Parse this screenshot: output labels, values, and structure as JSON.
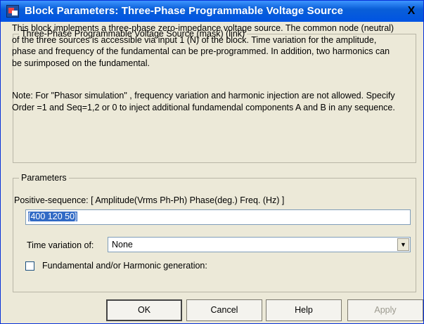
{
  "window": {
    "title": "Block Parameters: Three-Phase Programmable Voltage Source",
    "close_label": "X"
  },
  "description_group": {
    "legend": "Three-Phase Programmable Voltage Source (mask) (link)",
    "text": "This block implements a three-phase zero-impedance voltage source. The common node (neutral) of the three sources is accessible via input 1 (N) of the block. Time variation for the amplitude, phase and frequency of the fundamental can be pre-programmed. In addition, two harmonics can be surimposed on the fundamental.",
    "note": "Note: For \"Phasor simulation\" , frequency variation and harmonic injection are not allowed. Specify Order =1 and Seq=1,2 or 0 to inject additional fundamendal components A and B in any sequence."
  },
  "parameters": {
    "legend": "Parameters",
    "positive_sequence_label": "Positive-sequence: [ Amplitude(Vrms Ph-Ph) Phase(deg.) Freq. (Hz) ]",
    "positive_sequence_value": "[400 120 50]",
    "time_variation_label": "Time variation of:",
    "time_variation_value": "None",
    "harmonic_label": "Fundamental and/or Harmonic generation:",
    "harmonic_checked": false
  },
  "buttons": {
    "ok": "OK",
    "cancel": "Cancel",
    "help": "Help",
    "apply": "Apply"
  }
}
